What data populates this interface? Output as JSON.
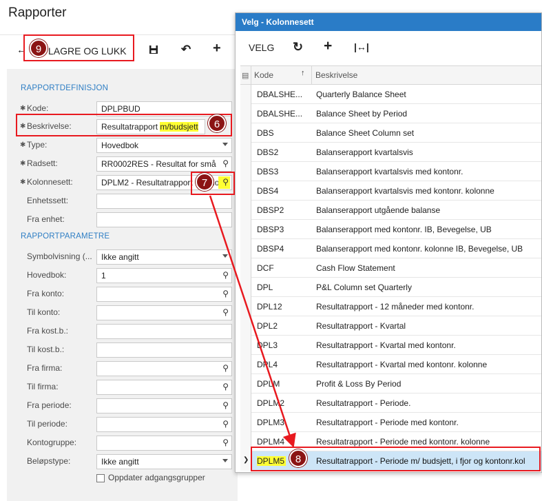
{
  "page": {
    "title": "Rapporter"
  },
  "toolbar": {
    "back_icon": "arrow-left",
    "save_close_label": "LAGRE OG LUKK",
    "save_icon": "disk",
    "undo_icon": "undo",
    "add_icon": "plus"
  },
  "form": {
    "section1": "RAPPORTDEFINISJON",
    "section2": "RAPPORTPARAMETRE",
    "code": {
      "label": "Kode:",
      "value": "DPLPBUD",
      "required": true
    },
    "description": {
      "label": "Beskrivelse:",
      "value_prefix": "Resultatrapport ",
      "value_highlight": "m/budsjett",
      "required": true
    },
    "type": {
      "label": "Type:",
      "value": "Hovedbok",
      "required": true
    },
    "row_set": {
      "label": "Radsett:",
      "value": "RR0002RES - Resultat for små",
      "required": true
    },
    "column_set": {
      "label": "Kolonnesett:",
      "value": "DPLM2 - Resultatrapport - Periode",
      "required": true
    },
    "unit_set": {
      "label": "Enhetssett:",
      "value": ""
    },
    "from_unit": {
      "label": "Fra enhet:",
      "value": ""
    },
    "symbol_display": {
      "label": "Symbolvisning (...",
      "value": "Ikke angitt"
    },
    "ledger": {
      "label": "Hovedbok:",
      "value": "1"
    },
    "from_account": {
      "label": "Fra konto:",
      "value": ""
    },
    "to_account": {
      "label": "Til konto:",
      "value": ""
    },
    "from_cost": {
      "label": "Fra kost.b.:",
      "value": ""
    },
    "to_cost": {
      "label": "Til kost.b.:",
      "value": ""
    },
    "from_company": {
      "label": "Fra firma:",
      "value": ""
    },
    "to_company": {
      "label": "Til firma:",
      "value": ""
    },
    "from_period": {
      "label": "Fra periode:",
      "value": ""
    },
    "to_period": {
      "label": "Til periode:",
      "value": ""
    },
    "account_group": {
      "label": "Kontogruppe:",
      "value": ""
    },
    "amount_type": {
      "label": "Beløpstype:",
      "value": "Ikke angitt"
    },
    "update_groups": {
      "label": "Oppdater adgangsgrupper",
      "checked": false
    }
  },
  "dialog": {
    "title": "Velg - Kolonnesett",
    "select_label": "VELG",
    "columns": {
      "code": "Kode",
      "description": "Beskrivelse"
    },
    "rows": [
      {
        "code": "DBALSHE...",
        "description": "Quarterly Balance Sheet"
      },
      {
        "code": "DBALSHE...",
        "description": "Balance Sheet by Period"
      },
      {
        "code": "DBS",
        "description": "Balance Sheet Column set"
      },
      {
        "code": "DBS2",
        "description": "Balanserapport kvartalsvis"
      },
      {
        "code": "DBS3",
        "description": "Balanserapport kvartalsvis med kontonr."
      },
      {
        "code": "DBS4",
        "description": "Balanserapport kvartalsvis med kontonr. kolonne"
      },
      {
        "code": "DBSP2",
        "description": "Balanserapport utgående balanse"
      },
      {
        "code": "DBSP3",
        "description": "Balanserapport med kontonr. IB, Bevegelse, UB"
      },
      {
        "code": "DBSP4",
        "description": "Balanserapport med kontonr. kolonne IB, Bevegelse, UB"
      },
      {
        "code": "DCF",
        "description": "Cash Flow Statement"
      },
      {
        "code": "DPL",
        "description": "P&L Column set Quarterly"
      },
      {
        "code": "DPL12",
        "description": "Resultatrapport - 12 måneder med kontonr."
      },
      {
        "code": "DPL2",
        "description": "Resultatrapport - Kvartal"
      },
      {
        "code": "DPL3",
        "description": "Resultatrapport - Kvartal med kontonr."
      },
      {
        "code": "DPL4",
        "description": "Resultatrapport - Kvartal med kontonr. kolonne"
      },
      {
        "code": "DPLM",
        "description": "Profit & Loss By Period"
      },
      {
        "code": "DPLM2",
        "description": "Resultatrapport - Periode."
      },
      {
        "code": "DPLM3",
        "description": "Resultatrapport - Periode med kontonr."
      },
      {
        "code": "DPLM4",
        "description": "Resultatrapport - Periode med kontonr. kolonne"
      },
      {
        "code": "DPLM5",
        "description": "Resultatrapport - Periode m/ budsjett, i fjor og kontonr.kol"
      }
    ]
  },
  "annotations": {
    "step6": "6",
    "step7": "7",
    "step8": "8",
    "step9": "9"
  },
  "colors": {
    "accent": "#2a7cc7",
    "annotation": "#e8191f",
    "badge": "#8b1414",
    "highlight": "#ffff33",
    "selected_row": "#cde5f7"
  }
}
